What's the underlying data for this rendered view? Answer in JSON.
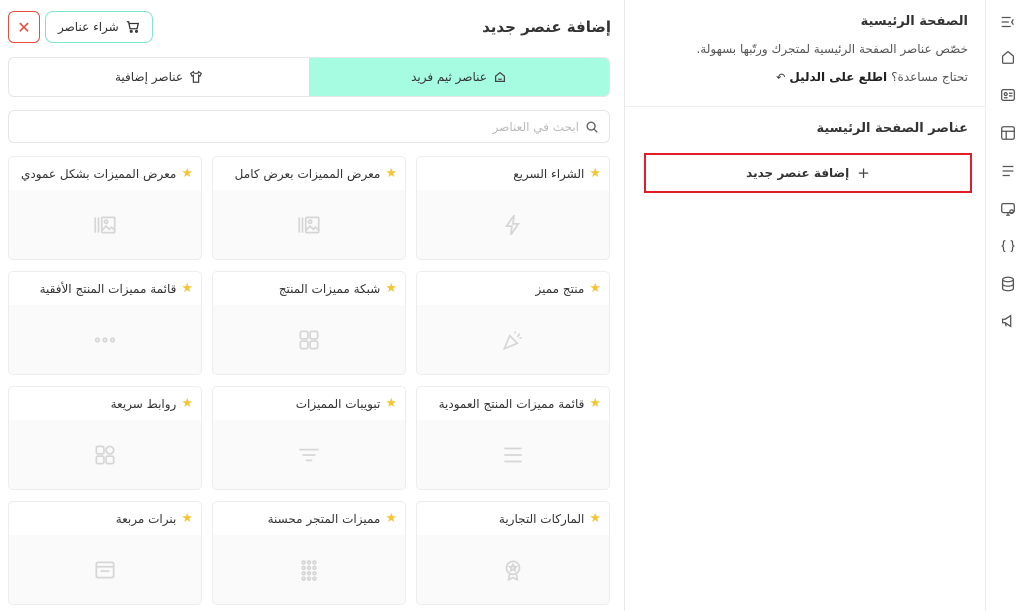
{
  "rail": {
    "icons": [
      "collapse-menu-icon",
      "home-icon",
      "id-card-icon",
      "layout-icon",
      "list-icon",
      "monitor-settings-icon",
      "code-braces-icon",
      "database-icon",
      "megaphone-icon"
    ]
  },
  "sidebar": {
    "page_title": "الصفحة الرئيسية",
    "page_desc": "خصّص عناصر الصفحة الرئيسية لمتجرك ورتّبها بسهولة.",
    "help_text": "تحتاج مساعدة؟",
    "help_link": "اطلع على الدليل",
    "section_title": "عناصر الصفحة الرئيسية",
    "add_button": "إضافة عنصر جديد"
  },
  "panel": {
    "title": "إضافة عنصر جديد",
    "buy_button": "شراء عناصر",
    "tabs": [
      {
        "label": "عناصر ثيم فريد",
        "active": true
      },
      {
        "label": "عناصر إضافية",
        "active": false
      }
    ],
    "search_placeholder": "ابحث في العناصر"
  },
  "elements": [
    {
      "label": "الشراء السريع",
      "icon": "lightning-icon"
    },
    {
      "label": "معرض المميزات بعرض كامل",
      "icon": "gallery-icon"
    },
    {
      "label": "معرض المميزات بشكل عمودي",
      "icon": "gallery-icon"
    },
    {
      "label": "منتج مميز",
      "icon": "party-popper-icon"
    },
    {
      "label": "شبكة مميزات المنتج",
      "icon": "grid-icon"
    },
    {
      "label": "قائمة مميزات المنتج الأفقية",
      "icon": "dots-icon"
    },
    {
      "label": "قائمة مميزات المنتج العمودية",
      "icon": "lines-icon"
    },
    {
      "label": "تبويبات المميزات",
      "icon": "filter-lines-icon"
    },
    {
      "label": "روابط سريعة",
      "icon": "apps-icon"
    },
    {
      "label": "الماركات التجارية",
      "icon": "badge-icon"
    },
    {
      "label": "مميزات المتجر محسنة",
      "icon": "dot-grid-icon"
    },
    {
      "label": "بنرات مربعة",
      "icon": "window-icon"
    }
  ],
  "colors": {
    "active_tab": "#a6fce0",
    "highlight_border": "#e11d2a",
    "star": "#f7c531",
    "close": "#e74c3c"
  }
}
